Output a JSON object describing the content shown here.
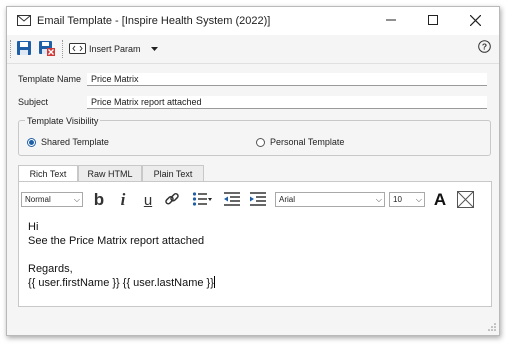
{
  "window": {
    "title": "Email Template - [Inspire Health System (2022)]",
    "controls": [
      "minimize-icon",
      "maximize-icon",
      "close-icon"
    ]
  },
  "toolbar": {
    "save_icon": "save-icon",
    "save_close_icon": "save-close-icon",
    "insert_param_label": "Insert Param",
    "help_icon": "help-icon"
  },
  "form": {
    "template_name_label": "Template Name",
    "template_name_value": "Price Matrix",
    "subject_label": "Subject",
    "subject_value": "Price Matrix report attached"
  },
  "visibility": {
    "legend": "Template Visibility",
    "options": [
      {
        "label": "Shared Template",
        "selected": true
      },
      {
        "label": "Personal Template",
        "selected": false
      }
    ]
  },
  "tabs": [
    {
      "label": "Rich Text",
      "active": true
    },
    {
      "label": "Raw HTML",
      "active": false
    },
    {
      "label": "Plain Text",
      "active": false
    }
  ],
  "format_toolbar": {
    "paragraph_style": "Normal",
    "font_family": "Arial",
    "font_size": "10",
    "icons": [
      "bold-icon",
      "italic-icon",
      "underline-icon",
      "link-icon",
      "bullet-list-icon",
      "outdent-icon",
      "indent-icon",
      "font-color-icon",
      "clear-formatting-icon"
    ]
  },
  "editor": {
    "lines": [
      "Hi",
      "See the Price Matrix report attached",
      "",
      "Regards,",
      "{{ user.firstName }} {{ user.lastName }}"
    ]
  },
  "colors": {
    "accent": "#1f5fa8",
    "delete_red": "#d23a3a",
    "window_bg": "#f5f5f5"
  }
}
